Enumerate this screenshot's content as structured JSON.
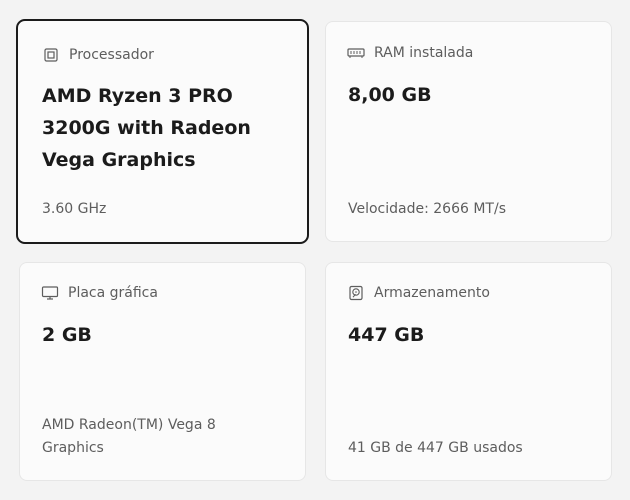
{
  "processor": {
    "label": "Processador",
    "value": "AMD Ryzen 3 PRO 3200G with Radeon Vega Graphics",
    "detail": "3.60 GHz",
    "icon": "processor-icon"
  },
  "ram": {
    "label": "RAM instalada",
    "value": "8,00 GB",
    "detail": "Velocidade: 2666 MT/s",
    "icon": "ram-icon"
  },
  "gpu": {
    "label": "Placa gráfica",
    "value": "2 GB",
    "detail": "AMD Radeon(TM) Vega 8 Graphics",
    "icon": "gpu-icon"
  },
  "storage": {
    "label": "Armazenamento",
    "value": "447 GB",
    "detail": "41 GB de 447 GB usados",
    "icon": "storage-icon"
  },
  "colors": {
    "page_bg": "#f3f3f3",
    "card_bg": "#fbfbfb",
    "selected_border": "#1b1b1b",
    "primary_text": "#1b1b1b",
    "secondary_text": "#5d5d5d"
  }
}
